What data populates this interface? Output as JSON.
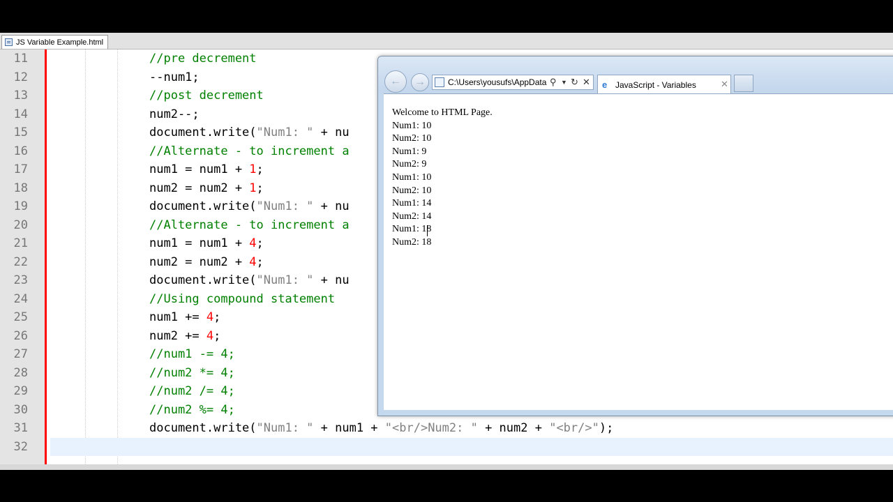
{
  "editor": {
    "tab_label": "JS Variable Example.html",
    "lines": [
      {
        "n": "11",
        "tokens": [
          {
            "t": "//pre decrement",
            "c": "cmt"
          }
        ]
      },
      {
        "n": "12",
        "tokens": [
          {
            "t": "--num1;",
            "c": ""
          }
        ]
      },
      {
        "n": "13",
        "tokens": [
          {
            "t": "//post decrement",
            "c": "cmt"
          }
        ]
      },
      {
        "n": "14",
        "tokens": [
          {
            "t": "num2--;",
            "c": ""
          }
        ]
      },
      {
        "n": "15",
        "tokens": [
          {
            "t": "document.write(",
            "c": ""
          },
          {
            "t": "\"Num1: \"",
            "c": "str"
          },
          {
            "t": " + nu",
            "c": ""
          }
        ]
      },
      {
        "n": "16",
        "tokens": [
          {
            "t": "//Alternate - to increment a",
            "c": "cmt"
          }
        ]
      },
      {
        "n": "17",
        "tokens": [
          {
            "t": "num1 = num1 + ",
            "c": ""
          },
          {
            "t": "1",
            "c": "num"
          },
          {
            "t": ";",
            "c": ""
          }
        ]
      },
      {
        "n": "18",
        "tokens": [
          {
            "t": "num2 = num2 + ",
            "c": ""
          },
          {
            "t": "1",
            "c": "num"
          },
          {
            "t": ";",
            "c": ""
          }
        ]
      },
      {
        "n": "19",
        "tokens": [
          {
            "t": "document.write(",
            "c": ""
          },
          {
            "t": "\"Num1: \"",
            "c": "str"
          },
          {
            "t": " + nu",
            "c": ""
          }
        ]
      },
      {
        "n": "20",
        "tokens": [
          {
            "t": "//Alternate - to increment a",
            "c": "cmt"
          }
        ]
      },
      {
        "n": "21",
        "tokens": [
          {
            "t": "num1 = num1 + ",
            "c": ""
          },
          {
            "t": "4",
            "c": "num"
          },
          {
            "t": ";",
            "c": ""
          }
        ]
      },
      {
        "n": "22",
        "tokens": [
          {
            "t": "num2 = num2 + ",
            "c": ""
          },
          {
            "t": "4",
            "c": "num"
          },
          {
            "t": ";",
            "c": ""
          }
        ]
      },
      {
        "n": "23",
        "tokens": [
          {
            "t": "document.write(",
            "c": ""
          },
          {
            "t": "\"Num1: \"",
            "c": "str"
          },
          {
            "t": " + nu",
            "c": ""
          }
        ]
      },
      {
        "n": "24",
        "tokens": [
          {
            "t": "//Using compound statement",
            "c": "cmt"
          }
        ]
      },
      {
        "n": "25",
        "tokens": [
          {
            "t": "num1 += ",
            "c": ""
          },
          {
            "t": "4",
            "c": "num"
          },
          {
            "t": ";",
            "c": ""
          }
        ]
      },
      {
        "n": "26",
        "tokens": [
          {
            "t": "num2 += ",
            "c": ""
          },
          {
            "t": "4",
            "c": "num"
          },
          {
            "t": ";",
            "c": ""
          }
        ]
      },
      {
        "n": "27",
        "tokens": [
          {
            "t": "//num1 -= 4;",
            "c": "cmt"
          }
        ]
      },
      {
        "n": "28",
        "tokens": [
          {
            "t": "//num2 *= 4;",
            "c": "cmt"
          }
        ]
      },
      {
        "n": "29",
        "tokens": [
          {
            "t": "//num2 /= 4;",
            "c": "cmt"
          }
        ]
      },
      {
        "n": "30",
        "tokens": [
          {
            "t": "//num2 %= 4;",
            "c": "cmt"
          }
        ]
      },
      {
        "n": "31",
        "tokens": [
          {
            "t": "document.write(",
            "c": ""
          },
          {
            "t": "\"Num1: \"",
            "c": "str"
          },
          {
            "t": " + num1 + ",
            "c": ""
          },
          {
            "t": "\"<br/>Num2: \"",
            "c": "str"
          },
          {
            "t": " + num2 + ",
            "c": ""
          },
          {
            "t": "\"<br/>\"",
            "c": "str"
          },
          {
            "t": ");",
            "c": ""
          }
        ]
      },
      {
        "n": "32",
        "tokens": [],
        "current": true
      }
    ]
  },
  "browser": {
    "address": "C:\\Users\\yousufs\\AppData",
    "tab_title": "JavaScript - Variables",
    "output_lines": [
      "Welcome to HTML Page.",
      "Num1: 10",
      "Num2: 10",
      "Num1: 9",
      "Num2: 9",
      "Num1: 10",
      "Num2: 10",
      "Num1: 14",
      "Num2: 14",
      "Num1: 18",
      "Num2: 18"
    ]
  },
  "colors": {
    "comment": "#008000",
    "string": "#808080",
    "number": "#ff0000",
    "fold_margin": "#ff0000",
    "current_line": "#e8f2fe"
  },
  "icons": {
    "back": "back-arrow-icon",
    "forward": "forward-arrow-icon",
    "search": "search-icon",
    "refresh": "refresh-icon",
    "stop": "close-icon",
    "browser": "ie-icon"
  }
}
